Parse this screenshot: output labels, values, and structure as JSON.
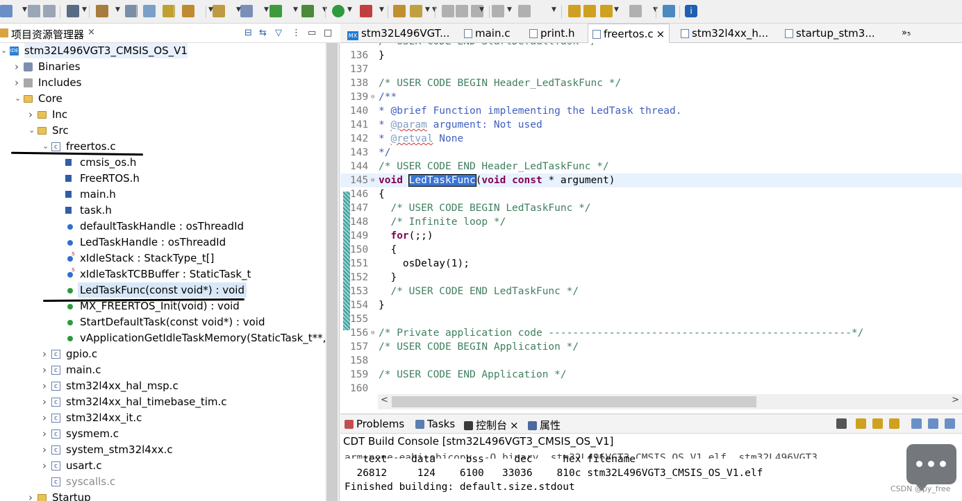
{
  "toolbar": {
    "icon_names": [
      "new-icon",
      "save-icon",
      "save-all-icon",
      "build-settings-icon",
      "build-icon",
      "binary-icon",
      "debug-config-icon",
      "touch-icon",
      "open-element-icon",
      "new-class-icon",
      "new-file-icon",
      "refresh-icon",
      "bug-icon",
      "run-icon",
      "external-tools-icon",
      "open-type-icon",
      "tool-icon",
      "format-icon",
      "comment-icon",
      "paragraph-icon",
      "next-annotation-icon",
      "prev-annotation-icon",
      "last-edit-icon",
      "forward-edit-icon",
      "back-icon",
      "forward-icon",
      "open-perspective-icon",
      "info-icon"
    ]
  },
  "explorer": {
    "title": "项目资源管理器",
    "tree": [
      {
        "label": "stm32L496VGT3_CMSIS_OS_V1",
        "icon": "project-icon",
        "twisty": "down",
        "selected": false
      },
      {
        "label": "Binaries",
        "icon": "binaries-icon",
        "twisty": "right"
      },
      {
        "label": "Includes",
        "icon": "includes-icon",
        "twisty": "right"
      },
      {
        "label": "Core",
        "icon": "folder-icon",
        "twisty": "down"
      },
      {
        "label": "Inc",
        "icon": "folder-icon",
        "twisty": "right"
      },
      {
        "label": "Src",
        "icon": "folder-icon",
        "twisty": "down"
      },
      {
        "label": "freertos.c",
        "icon": "c-file-icon",
        "twisty": "down"
      },
      {
        "label": "cmsis_os.h",
        "icon": "h-include-icon"
      },
      {
        "label": "FreeRTOS.h",
        "icon": "h-include-icon"
      },
      {
        "label": "main.h",
        "icon": "h-include-icon"
      },
      {
        "label": "task.h",
        "icon": "h-include-icon"
      },
      {
        "label": "defaultTaskHandle : osThreadId",
        "icon": "variable-icon"
      },
      {
        "label": "LedTaskHandle : osThreadId",
        "icon": "variable-icon"
      },
      {
        "label": "xIdleStack : StackType_t[]",
        "icon": "static-variable-icon"
      },
      {
        "label": "xIdleTaskTCBBuffer : StaticTask_t",
        "icon": "static-variable-icon"
      },
      {
        "label": "LedTaskFunc(const void*) : void",
        "icon": "function-icon",
        "selected": true
      },
      {
        "label": "MX_FREERTOS_Init(void) : void",
        "icon": "function-icon"
      },
      {
        "label": "StartDefaultTask(const void*) : void",
        "icon": "function-icon"
      },
      {
        "label": "vApplicationGetIdleTaskMemory(StaticTask_t**,",
        "icon": "function-icon"
      },
      {
        "label": "gpio.c",
        "icon": "c-file-icon",
        "twisty": "right"
      },
      {
        "label": "main.c",
        "icon": "c-file-icon",
        "twisty": "right"
      },
      {
        "label": "stm32l4xx_hal_msp.c",
        "icon": "c-file-icon",
        "twisty": "right"
      },
      {
        "label": "stm32l4xx_hal_timebase_tim.c",
        "icon": "c-file-icon",
        "twisty": "right"
      },
      {
        "label": "stm32l4xx_it.c",
        "icon": "c-file-icon",
        "twisty": "right"
      },
      {
        "label": "sysmem.c",
        "icon": "c-file-icon",
        "twisty": "right"
      },
      {
        "label": "system_stm32l4xx.c",
        "icon": "c-file-icon",
        "twisty": "right"
      },
      {
        "label": "usart.c",
        "icon": "c-file-icon",
        "twisty": "right"
      },
      {
        "label": "syscalls.c",
        "icon": "c-file-excluded-icon",
        "dim": true
      },
      {
        "label": "Startup",
        "icon": "folder-icon",
        "twisty": "right"
      }
    ]
  },
  "editor": {
    "tabs": [
      {
        "label": "stm32L496VGT...",
        "icon": "mx-icon",
        "active": false
      },
      {
        "label": "main.c",
        "icon": "c-file-icon",
        "active": false
      },
      {
        "label": "print.h",
        "icon": "h-file-icon",
        "active": false
      },
      {
        "label": "freertos.c",
        "icon": "c-file-icon",
        "active": true,
        "close": "×"
      },
      {
        "label": "stm32l4xx_h...",
        "icon": "c-file-icon",
        "active": false
      },
      {
        "label": "startup_stm3...",
        "icon": "s-file-icon",
        "active": false
      }
    ],
    "overflow": "»₅",
    "lines": [
      {
        "n": "136",
        "text": "}"
      },
      {
        "n": "137",
        "text": ""
      },
      {
        "n": "138",
        "text": "/* USER CODE BEGIN Header_LedTaskFunc */"
      },
      {
        "n": "139",
        "text": "/**",
        "fold": true
      },
      {
        "n": "140",
        "text": "* @brief Function implementing the LedTask thread."
      },
      {
        "n": "141",
        "text": "* @param argument: Not used"
      },
      {
        "n": "142",
        "text": "* @retval None"
      },
      {
        "n": "143",
        "text": "*/"
      },
      {
        "n": "144",
        "text": "/* USER CODE END Header_LedTaskFunc */"
      },
      {
        "n": "145",
        "text": "void LedTaskFunc(void const * argument)",
        "fold": true
      },
      {
        "n": "146",
        "text": "{"
      },
      {
        "n": "147",
        "text": "  /* USER CODE BEGIN LedTaskFunc */"
      },
      {
        "n": "148",
        "text": "  /* Infinite loop */"
      },
      {
        "n": "149",
        "text": "  for(;;)"
      },
      {
        "n": "150",
        "text": "  {"
      },
      {
        "n": "151",
        "text": "    osDelay(1);"
      },
      {
        "n": "152",
        "text": "  }"
      },
      {
        "n": "153",
        "text": "  /* USER CODE END LedTaskFunc */"
      },
      {
        "n": "154",
        "text": "}"
      },
      {
        "n": "155",
        "text": ""
      },
      {
        "n": "156",
        "text": "/* Private application code --------------------------------------------------*/",
        "fold": true
      },
      {
        "n": "157",
        "text": "/* USER CODE BEGIN Application */"
      },
      {
        "n": "158",
        "text": ""
      },
      {
        "n": "159",
        "text": "/* USER CODE END Application */"
      },
      {
        "n": "160",
        "text": ""
      }
    ],
    "clipped_line": "/* USER CODE END StartDefaultTask */"
  },
  "console": {
    "tabs": [
      {
        "label": "Problems",
        "icon": "problems-icon"
      },
      {
        "label": "Tasks",
        "icon": "tasks-icon"
      },
      {
        "label": "控制台",
        "icon": "console-icon",
        "active": true,
        "close": "×"
      },
      {
        "label": "属性",
        "icon": "properties-icon"
      }
    ],
    "title": "CDT Build Console [stm32L496VGT3_CMSIS_OS_V1]",
    "header": "   text    data     bss     dec     hex filename",
    "values": "  26812     124    6100   33036    810c stm32L496VGT3_CMSIS_OS_V1.elf",
    "footer": "Finished building: default.size.stdout"
  },
  "watermark": "CSDN @py_free",
  "colors": {
    "keyword": "#7f0055",
    "comment": "#3f7f5f",
    "javadoc": "#3f5fbf",
    "selection": "#3875d7",
    "highlight_line": "#e8f2fe"
  }
}
